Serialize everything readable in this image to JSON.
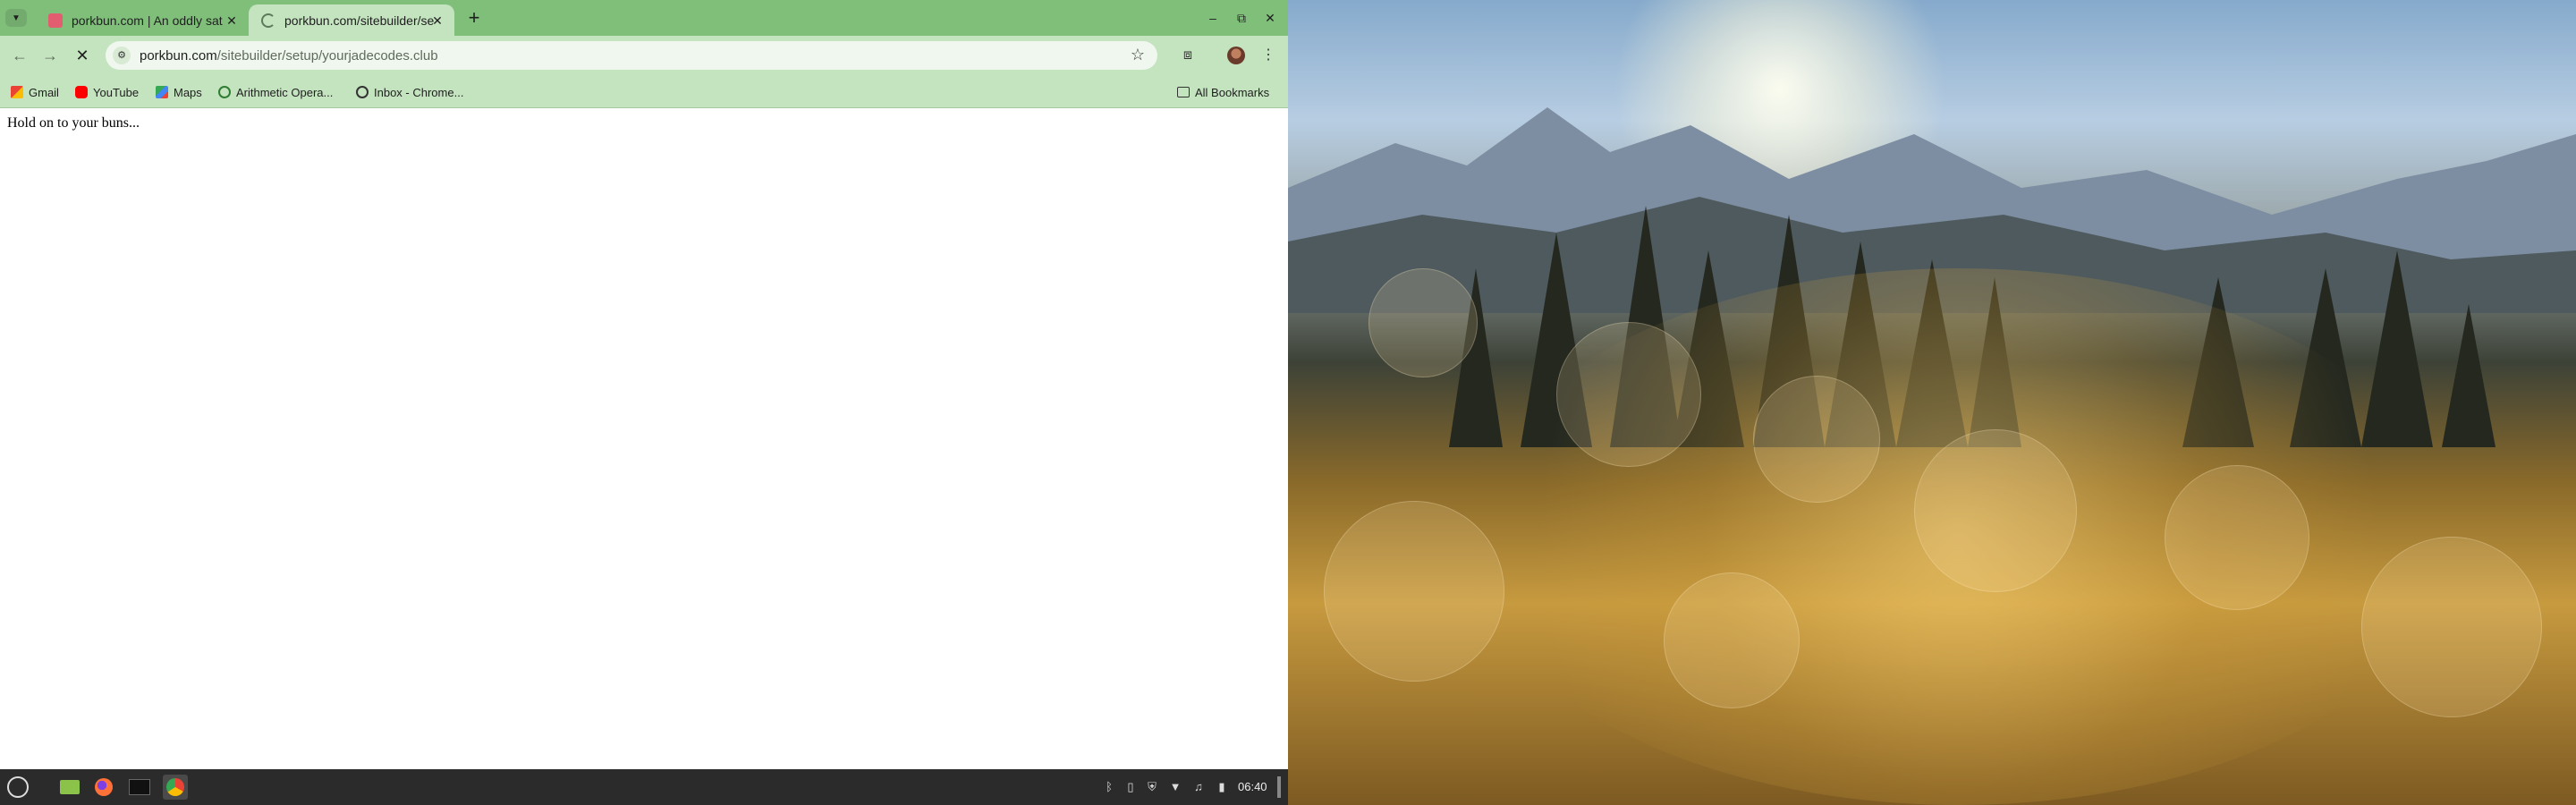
{
  "browser": {
    "tabs": [
      {
        "title": "porkbun.com | An oddly sat",
        "active": false
      },
      {
        "title": "porkbun.com/sitebuilder/se",
        "active": true
      }
    ],
    "url": {
      "host": "porkbun.com",
      "path": "/sitebuilder/setup/yourjadecodes.club"
    },
    "bookmarks": [
      {
        "label": "Gmail",
        "icon": "gmail-icon"
      },
      {
        "label": "YouTube",
        "icon": "youtube-icon"
      },
      {
        "label": "Maps",
        "icon": "maps-icon"
      },
      {
        "label": "Arithmetic Opera...",
        "icon": "globe-icon"
      },
      {
        "label": "Inbox - Chrome...",
        "icon": "globe-icon"
      }
    ],
    "all_bookmarks_label": "All Bookmarks",
    "page_message": "Hold on to your buns..."
  },
  "taskbar": {
    "clock": "06:40"
  },
  "colors": {
    "theme_green": "#7fbf7a",
    "toolbar_green": "#c4e3bf",
    "taskbar": "#2b2b2b"
  }
}
